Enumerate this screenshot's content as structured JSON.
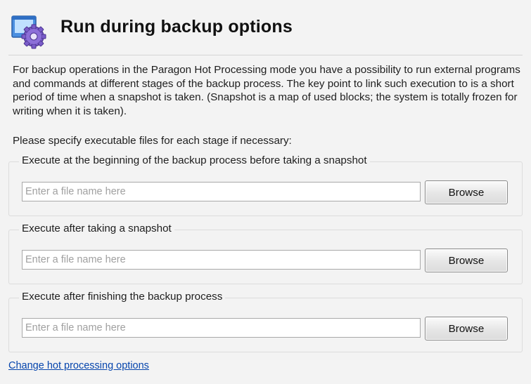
{
  "header": {
    "title": "Run during backup options",
    "icon": "settings-gear-icon"
  },
  "description": "For backup operations in the Paragon Hot Processing mode you have a possibility to run external programs and commands at different stages of the backup process. The key point to link such execution to is a short period of time when a snapshot is taken. (Snapshot is a map of used blocks; the system is totally frozen for writing when it is taken).",
  "instruction": "Please specify executable files for each stage if necessary:",
  "stages": [
    {
      "label": "Execute at the beginning of the backup process before taking a snapshot",
      "value": "",
      "placeholder": "Enter a file name here",
      "button": "Browse"
    },
    {
      "label": "Execute after taking a snapshot",
      "value": "",
      "placeholder": "Enter a file name here",
      "button": "Browse"
    },
    {
      "label": "Execute after finishing the backup process",
      "value": "",
      "placeholder": "Enter a file name here",
      "button": "Browse"
    }
  ],
  "footer_link": "Change hot processing options",
  "colors": {
    "background": "#f3f3f3",
    "link": "#0645ad",
    "icon_blue": "#3a7bd5",
    "gear_purple": "#7a5cc9"
  }
}
